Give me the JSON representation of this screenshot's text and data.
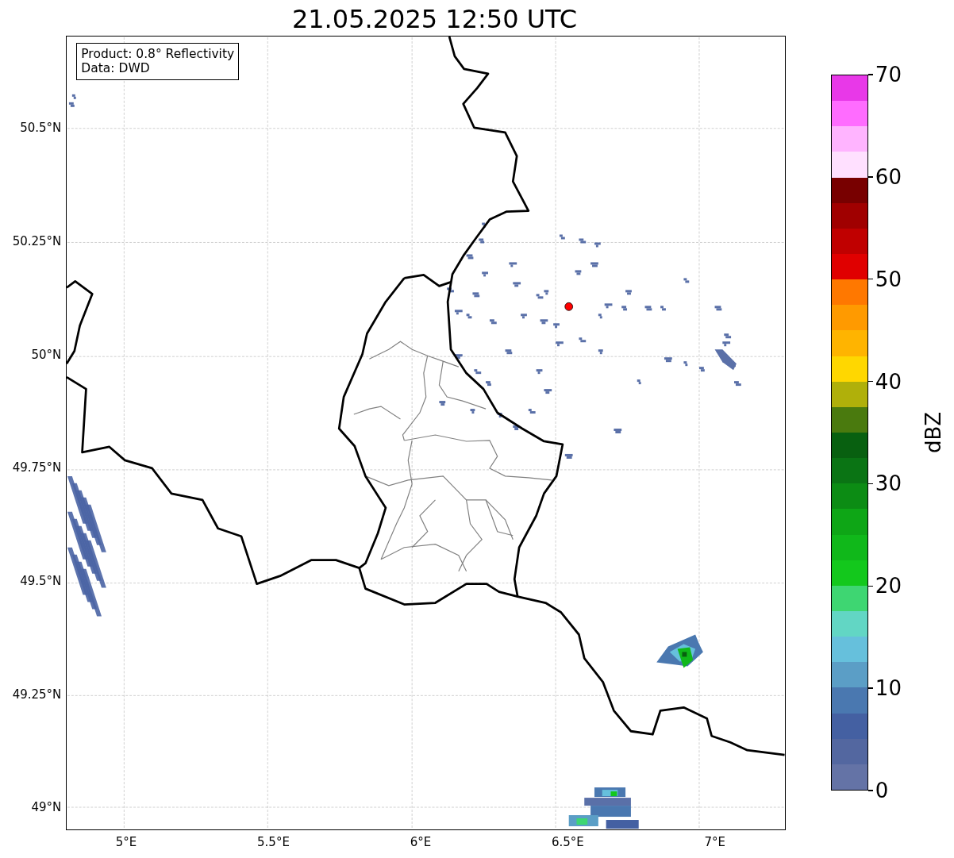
{
  "title": "21.05.2025 12:50 UTC",
  "legend": {
    "lines": [
      "Product: 0.8° Reflectivity",
      "Data: DWD"
    ]
  },
  "map": {
    "lat_ticks": [
      "50.5°N",
      "50.25°N",
      "50°N",
      "49.75°N",
      "49.5°N",
      "49.25°N",
      "49°N"
    ],
    "lon_ticks": [
      "5°E",
      "5.5°E",
      "6°E",
      "6.5°E",
      "7°E"
    ]
  },
  "colorbar": {
    "label": "dBZ",
    "ticks": [
      "70",
      "60",
      "50",
      "40",
      "30",
      "20",
      "10",
      "0"
    ],
    "bands": [
      {
        "color": "#e838e8"
      },
      {
        "color": "#ff6cff"
      },
      {
        "color": "#ffb4ff"
      },
      {
        "color": "#ffe0ff"
      },
      {
        "color": "#780000"
      },
      {
        "color": "#a00000"
      },
      {
        "color": "#c00000"
      },
      {
        "color": "#e00000"
      },
      {
        "color": "#ff7800"
      },
      {
        "color": "#ff9a00"
      },
      {
        "color": "#ffb400"
      },
      {
        "color": "#ffd700"
      },
      {
        "color": "#b0b00a"
      },
      {
        "color": "#4a7a0e"
      },
      {
        "color": "#086010"
      },
      {
        "color": "#0a7414"
      },
      {
        "color": "#0c8c14"
      },
      {
        "color": "#0ea616"
      },
      {
        "color": "#10b81a"
      },
      {
        "color": "#13c81c"
      },
      {
        "color": "#3ed672"
      },
      {
        "color": "#62d6c4"
      },
      {
        "color": "#66c0dc"
      },
      {
        "color": "#5b9ec6"
      },
      {
        "color": "#4a78b0"
      },
      {
        "color": "#4460a2"
      },
      {
        "color": "#5367a0"
      },
      {
        "color": "#6473a6"
      }
    ]
  }
}
